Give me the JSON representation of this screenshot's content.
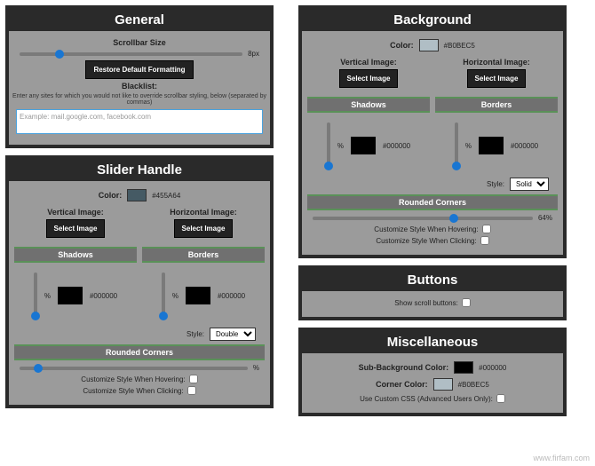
{
  "watermark": "www.firfam.com",
  "general": {
    "title": "General",
    "scrollbar_size_label": "Scrollbar Size",
    "scrollbar_size_val": "8px",
    "restore_btn": "Restore Default Formatting",
    "blacklist_label": "Blacklist:",
    "blacklist_help": "Enter any sites for which you would not like to override scrollbar styling, below (separated by commas)",
    "blacklist_placeholder": "Example: mail.google.com, facebook.com"
  },
  "slider": {
    "title": "Slider Handle",
    "color_label": "Color:",
    "color_swatch": "#455A64",
    "color_hex": "#455A64",
    "vimg_label": "Vertical Image:",
    "himg_label": "Horizontal Image:",
    "select_btn": "Select Image",
    "shadows_title": "Shadows",
    "borders_title": "Borders",
    "pct": "%",
    "hex": "#000000",
    "style_label": "Style:",
    "style_value": "Double",
    "rounded_title": "Rounded Corners",
    "hover_label": "Customize Style When Hovering:",
    "click_label": "Customize Style When Clicking:"
  },
  "background": {
    "title": "Background",
    "color_label": "Color:",
    "color_swatch": "#B0BEC5",
    "color_hex": "#B0BEC5",
    "vimg_label": "Vertical Image:",
    "himg_label": "Horizontal Image:",
    "select_btn": "Select Image",
    "shadows_title": "Shadows",
    "borders_title": "Borders",
    "pct": "%",
    "hex": "#000000",
    "style_label": "Style:",
    "style_value": "Solid",
    "rounded_title": "Rounded Corners",
    "rounded_val": "64%",
    "hover_label": "Customize Style When Hovering:",
    "click_label": "Customize Style When Clicking:"
  },
  "buttons": {
    "title": "Buttons",
    "show_label": "Show scroll buttons:"
  },
  "misc": {
    "title": "Miscellaneous",
    "subbg_label": "Sub-Background Color:",
    "subbg_hex": "#000000",
    "corner_label": "Corner Color:",
    "corner_swatch": "#B0BEC5",
    "corner_hex": "#B0BEC5",
    "css_label": "Use Custom CSS (Advanced Users Only):"
  }
}
